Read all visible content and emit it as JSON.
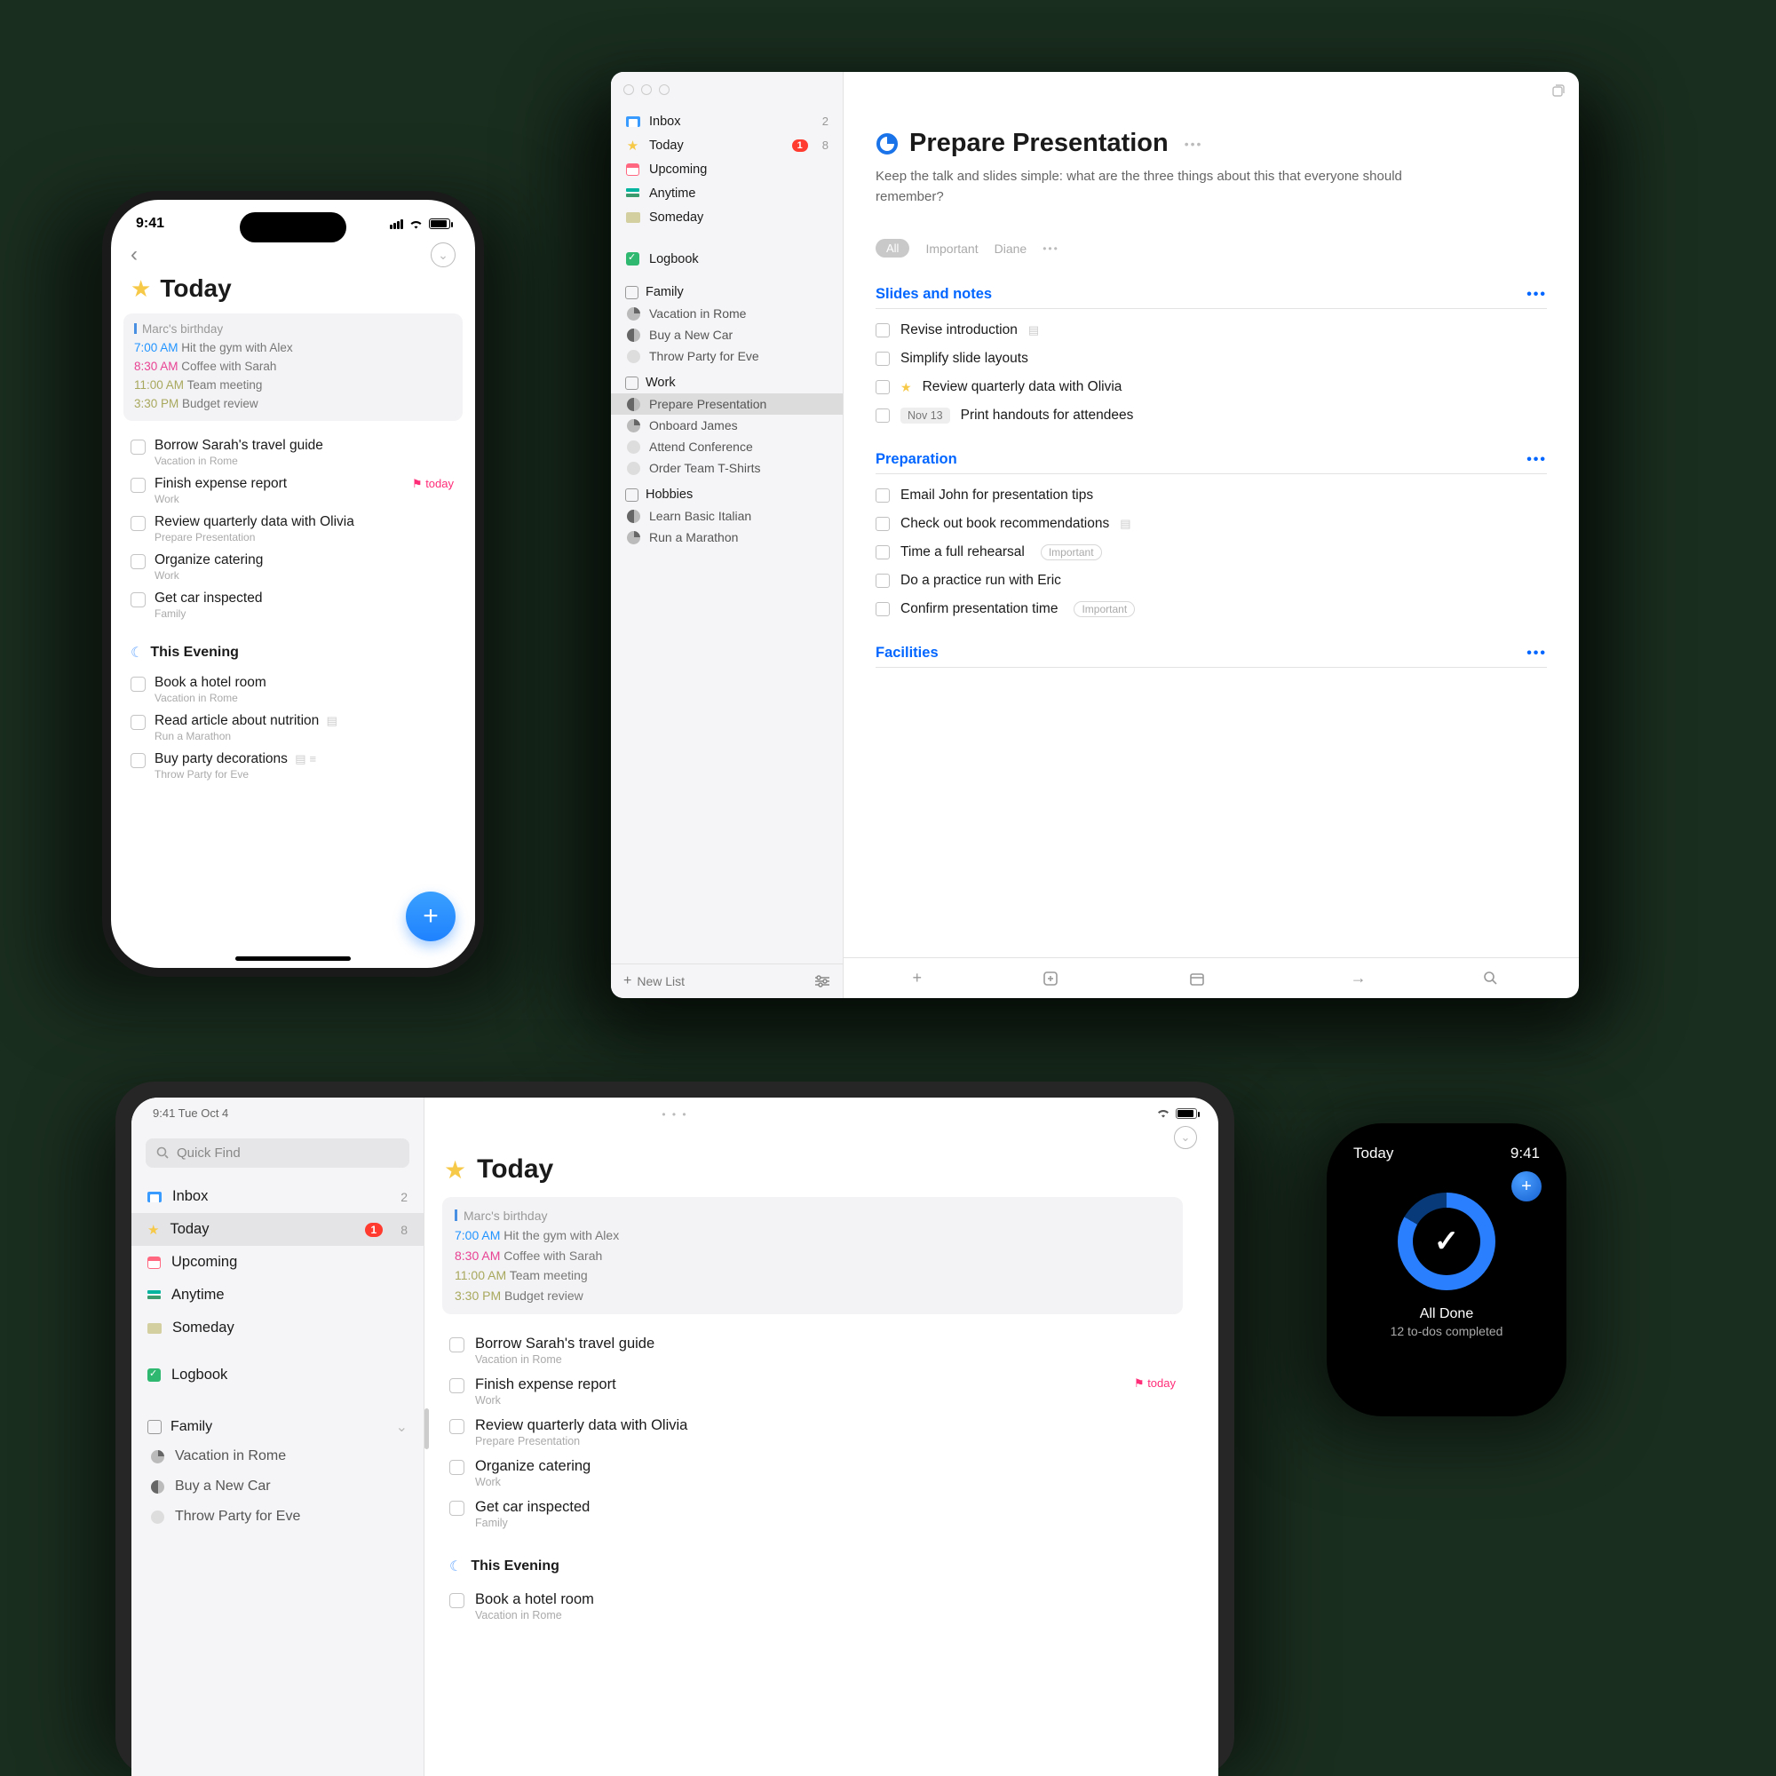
{
  "iphone": {
    "time": "9:41",
    "title": "Today",
    "events": {
      "birthday": "Marc's birthday",
      "rows": [
        {
          "time": "7:00 AM",
          "cls": "t-blue",
          "name": "Hit the gym with Alex"
        },
        {
          "time": "8:30 AM",
          "cls": "t-pink",
          "name": "Coffee with Sarah"
        },
        {
          "time": "11:00 AM",
          "cls": "t-olive",
          "name": "Team meeting"
        },
        {
          "time": "3:30 PM",
          "cls": "t-olive",
          "name": "Budget review"
        }
      ]
    },
    "todos": [
      {
        "title": "Borrow Sarah's travel guide",
        "sub": "Vacation in Rome"
      },
      {
        "title": "Finish expense report",
        "sub": "Work",
        "flag": "today"
      },
      {
        "title": "Review quarterly data with Olivia",
        "sub": "Prepare Presentation"
      },
      {
        "title": "Organize catering",
        "sub": "Work"
      },
      {
        "title": "Get car inspected",
        "sub": "Family"
      }
    ],
    "evening_title": "This Evening",
    "evening": [
      {
        "title": "Book a hotel room",
        "sub": "Vacation in Rome"
      },
      {
        "title": "Read article about nutrition",
        "sub": "Run a Marathon",
        "note": true
      },
      {
        "title": "Buy party decorations",
        "sub": "Throw Party for Eve",
        "chips": true
      }
    ]
  },
  "mac": {
    "sidebar": {
      "top": [
        {
          "icon": "inbox",
          "label": "Inbox",
          "count": "2"
        },
        {
          "icon": "star",
          "label": "Today",
          "badge": "1",
          "count": "8"
        },
        {
          "icon": "cal",
          "label": "Upcoming"
        },
        {
          "icon": "stack",
          "label": "Anytime"
        },
        {
          "icon": "someday",
          "label": "Someday"
        }
      ],
      "logbook": "Logbook",
      "areas": [
        {
          "name": "Family",
          "projects": [
            {
              "name": "Vacation in Rome",
              "pie": "qtr"
            },
            {
              "name": "Buy a New Car",
              "pie": "half"
            },
            {
              "name": "Throw Party for Eve",
              "pie": "empty"
            }
          ]
        },
        {
          "name": "Work",
          "projects": [
            {
              "name": "Prepare Presentation",
              "pie": "half",
              "selected": true
            },
            {
              "name": "Onboard James",
              "pie": "qtr"
            },
            {
              "name": "Attend Conference",
              "pie": "empty"
            },
            {
              "name": "Order Team T-Shirts",
              "pie": "empty"
            }
          ]
        },
        {
          "name": "Hobbies",
          "projects": [
            {
              "name": "Learn Basic Italian",
              "pie": "half"
            },
            {
              "name": "Run a Marathon",
              "pie": "qtr"
            }
          ]
        }
      ],
      "new_list": "New List"
    },
    "project": {
      "title": "Prepare Presentation",
      "desc": "Keep the talk and slides simple: what are the three things about this that everyone should remember?",
      "tags": {
        "all": "All",
        "t1": "Important",
        "t2": "Diane"
      },
      "headings": [
        {
          "title": "Slides and notes",
          "tasks": [
            {
              "title": "Revise introduction",
              "note": true
            },
            {
              "title": "Simplify slide layouts"
            },
            {
              "title": "Review quarterly data with Olivia",
              "star": true
            },
            {
              "title": "Print handouts for attendees",
              "date": "Nov 13"
            }
          ]
        },
        {
          "title": "Preparation",
          "tasks": [
            {
              "title": "Email John for presentation tips"
            },
            {
              "title": "Check out book recommendations",
              "note": true
            },
            {
              "title": "Time a full rehearsal",
              "imp": "Important"
            },
            {
              "title": "Do a practice run with Eric"
            },
            {
              "title": "Confirm presentation time",
              "imp": "Important"
            }
          ]
        },
        {
          "title": "Facilities",
          "tasks": []
        }
      ]
    }
  },
  "ipad": {
    "status_left": "9:41   Tue Oct 4",
    "quick_find": "Quick Find",
    "sidebar": {
      "top": [
        {
          "icon": "inbox",
          "label": "Inbox",
          "count": "2"
        },
        {
          "icon": "star",
          "label": "Today",
          "badge": "1",
          "count": "8",
          "sel": true
        },
        {
          "icon": "cal",
          "label": "Upcoming"
        },
        {
          "icon": "stack",
          "label": "Anytime"
        },
        {
          "icon": "someday",
          "label": "Someday"
        }
      ],
      "logbook": "Logbook",
      "area": {
        "name": "Family",
        "projects": [
          {
            "name": "Vacation in Rome",
            "pie": "qtr"
          },
          {
            "name": "Buy a New Car",
            "pie": "half"
          },
          {
            "name": "Throw Party for Eve",
            "pie": "empty"
          }
        ]
      }
    },
    "title": "Today",
    "events": {
      "birthday": "Marc's birthday",
      "rows": [
        {
          "time": "7:00 AM",
          "cls": "t-blue",
          "name": "Hit the gym with Alex"
        },
        {
          "time": "8:30 AM",
          "cls": "t-pink",
          "name": "Coffee with Sarah"
        },
        {
          "time": "11:00 AM",
          "cls": "t-olive",
          "name": "Team meeting"
        },
        {
          "time": "3:30 PM",
          "cls": "t-olive",
          "name": "Budget review"
        }
      ]
    },
    "todos": [
      {
        "title": "Borrow Sarah's travel guide",
        "sub": "Vacation in Rome"
      },
      {
        "title": "Finish expense report",
        "sub": "Work",
        "flag": "today"
      },
      {
        "title": "Review quarterly data with Olivia",
        "sub": "Prepare Presentation"
      },
      {
        "title": "Organize catering",
        "sub": "Work"
      },
      {
        "title": "Get car inspected",
        "sub": "Family"
      }
    ],
    "evening_title": "This Evening",
    "evening": [
      {
        "title": "Book a hotel room",
        "sub": "Vacation in Rome"
      }
    ]
  },
  "watch": {
    "title": "Today",
    "time": "9:41",
    "done": "All Done",
    "sub": "12 to-dos completed"
  }
}
